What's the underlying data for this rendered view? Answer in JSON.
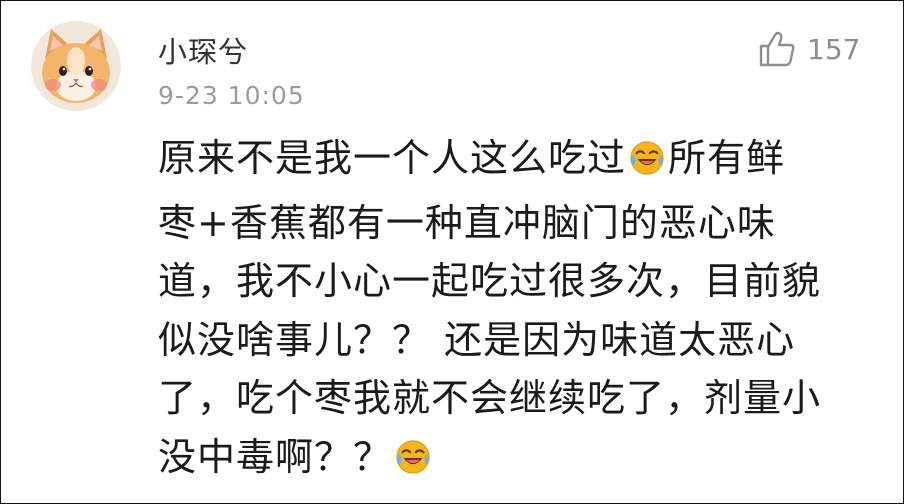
{
  "comment": {
    "username": "小琛兮",
    "timestamp": "9-23 10:05",
    "like_count": "157",
    "lines": [
      [
        "原来不是我一个人这么吃过",
        "emoji-laugh-cry",
        "所有鲜"
      ],
      [
        "枣+香蕉都有一种直冲脑门的恶心味"
      ],
      [
        "道，我不小心一起吃过很多次，目前貌"
      ],
      [
        "似没啥事儿？？ 还是因为味道太恶心"
      ],
      [
        "了，吃个枣我就不会继续吃了，剂量小"
      ],
      [
        "没中毒啊？？",
        "emoji-laugh-cry"
      ]
    ]
  },
  "icons": {
    "avatar": "cat-avatar",
    "like": "thumbs-up-icon",
    "emoji": "laugh-cry-emoji"
  },
  "colors": {
    "username": "#333333",
    "timestamp": "#9c9c9c",
    "like": "#8e8e8e",
    "text": "#1a1a1a",
    "emoji": "#f5b51b"
  }
}
